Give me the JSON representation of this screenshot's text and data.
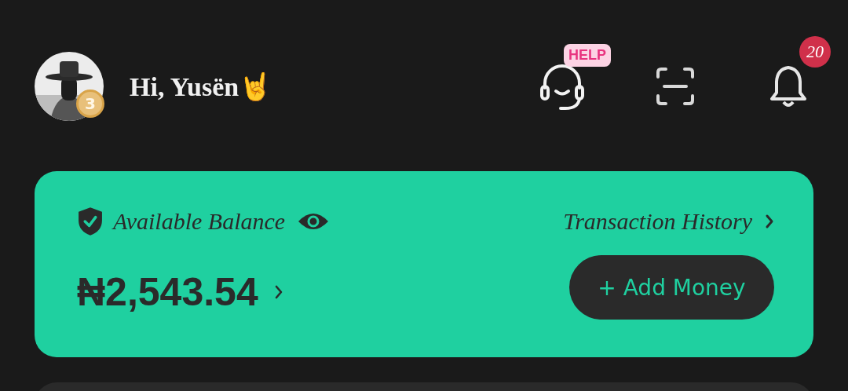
{
  "header": {
    "avatar": {
      "kind": "picture",
      "medal": "3"
    },
    "greeting": "Hi, Yusën🤘",
    "help_badge": "HELP",
    "notification_count": "20"
  },
  "balance_card": {
    "label": "Available Balance",
    "history_link": "Transaction History",
    "amount": "₦2,543.54",
    "add_button": "+ Add Money"
  }
}
